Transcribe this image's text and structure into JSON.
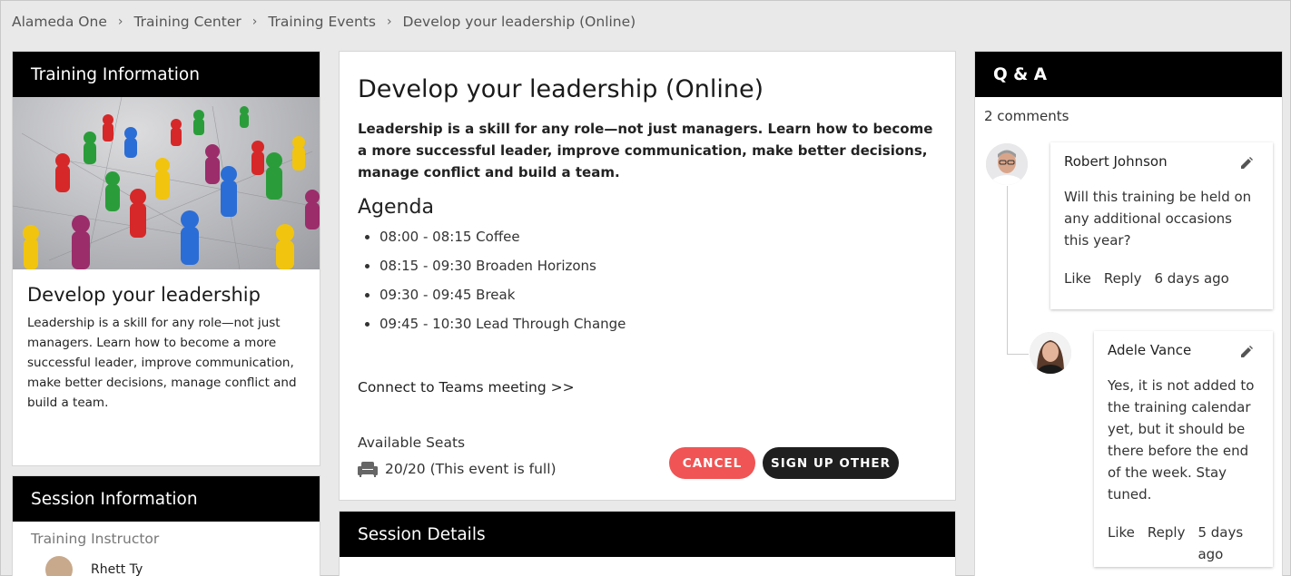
{
  "breadcrumb": [
    "Alameda One",
    "Training Center",
    "Training Events",
    "Develop your leadership (Online)"
  ],
  "training_info": {
    "header": "Training Information",
    "title": "Develop your leadership",
    "description": "Leadership is a skill for any role—not just managers. Learn how to become a more successful leader, improve communication, make better decisions, manage conflict and build a team."
  },
  "session_info": {
    "header": "Session Information",
    "instructor_label": "Training Instructor",
    "instructor_name": "Rhett Ty"
  },
  "event": {
    "title": "Develop your leadership (Online)",
    "lead": "Leadership is a skill for any role—not just managers. Learn how to become a more successful leader, improve communication, make better decisions, manage conflict and build a team.",
    "agenda_title": "Agenda",
    "agenda": [
      "08:00 - 08:15 Coffee",
      "08:15 - 09:30 Broaden Horizons",
      "09:30 - 09:45 Break",
      "09:45 - 10:30 Lead Through Change"
    ],
    "teams_link": "Connect to Teams meeting >>",
    "seats_label": "Available Seats",
    "seats_value": "20/20 (This event is full)",
    "cancel_label": "CANCEL",
    "signup_label": "SIGN UP OTHER"
  },
  "session_details": {
    "header": "Session Details"
  },
  "qa": {
    "header": "Q & A",
    "count": "2 comments",
    "comments": [
      {
        "author": "Robert Johnson",
        "body": "Will this training be held on any additional occasions this year?",
        "like": "Like",
        "reply": "Reply",
        "time": "6 days ago"
      },
      {
        "author": "Adele Vance",
        "body": "Yes, it is not added to the training calendar yet, but it should be there before the end of the week. Stay tuned.",
        "like": "Like",
        "reply": "Reply",
        "time": "5 days ago"
      }
    ]
  },
  "colors": {
    "header_bg": "#000000",
    "cancel": "#f05454",
    "signup": "#1f1f1f",
    "page_bg": "#e9e9e9"
  },
  "icons": {
    "seat": "armchair-icon",
    "edit": "pencil-icon",
    "separator": "chevron-right-icon"
  }
}
